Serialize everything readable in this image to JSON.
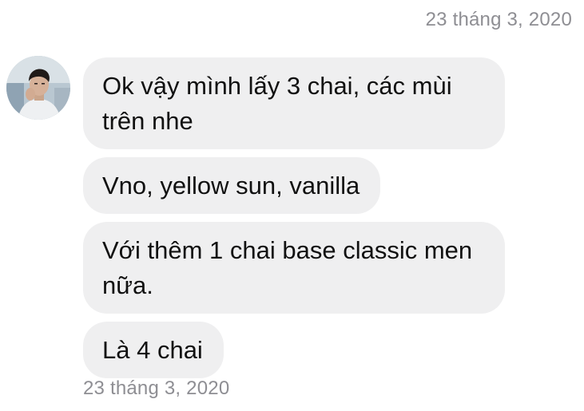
{
  "chat": {
    "date_top": "23 tháng 3, 2020",
    "date_bottom": "23 tháng 3, 2020",
    "messages": [
      {
        "text": "Ok vậy mình lấy 3 chai, các mùi trên nhe"
      },
      {
        "text": "Vno, yellow sun, vanilla"
      },
      {
        "text": "Với thêm 1 chai base classic men nữa."
      },
      {
        "text": "Là 4 chai"
      }
    ]
  },
  "colors": {
    "bubble_background": "#efeff0",
    "timestamp": "#8e8e93",
    "message_text": "#111111",
    "background": "#ffffff"
  }
}
